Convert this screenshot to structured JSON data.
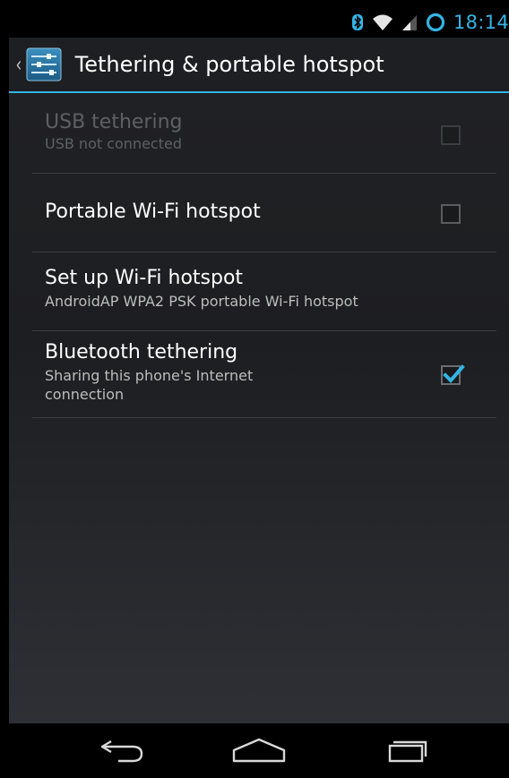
{
  "status_bar": {
    "time": "18:14",
    "icons": [
      "bluetooth-icon",
      "wifi-icon",
      "signal-icon",
      "battery-icon"
    ],
    "accent_color": "#33b5e5"
  },
  "action_bar": {
    "title": "Tethering & portable hotspot",
    "icon": "settings-icon"
  },
  "items": [
    {
      "title": "USB tethering",
      "summary": "USB not connected",
      "checked": false,
      "enabled": false
    },
    {
      "title": "Portable Wi-Fi hotspot",
      "checked": false,
      "enabled": true
    },
    {
      "title": "Set up Wi-Fi hotspot",
      "summary": "AndroidAP WPA2 PSK portable Wi-Fi hotspot",
      "enabled": true
    },
    {
      "title": "Bluetooth tethering",
      "summary": "Sharing this phone's Internet connection",
      "checked": true,
      "enabled": true
    }
  ],
  "nav_bar": {
    "buttons": [
      "back-icon",
      "home-icon",
      "recent-apps-icon"
    ]
  }
}
